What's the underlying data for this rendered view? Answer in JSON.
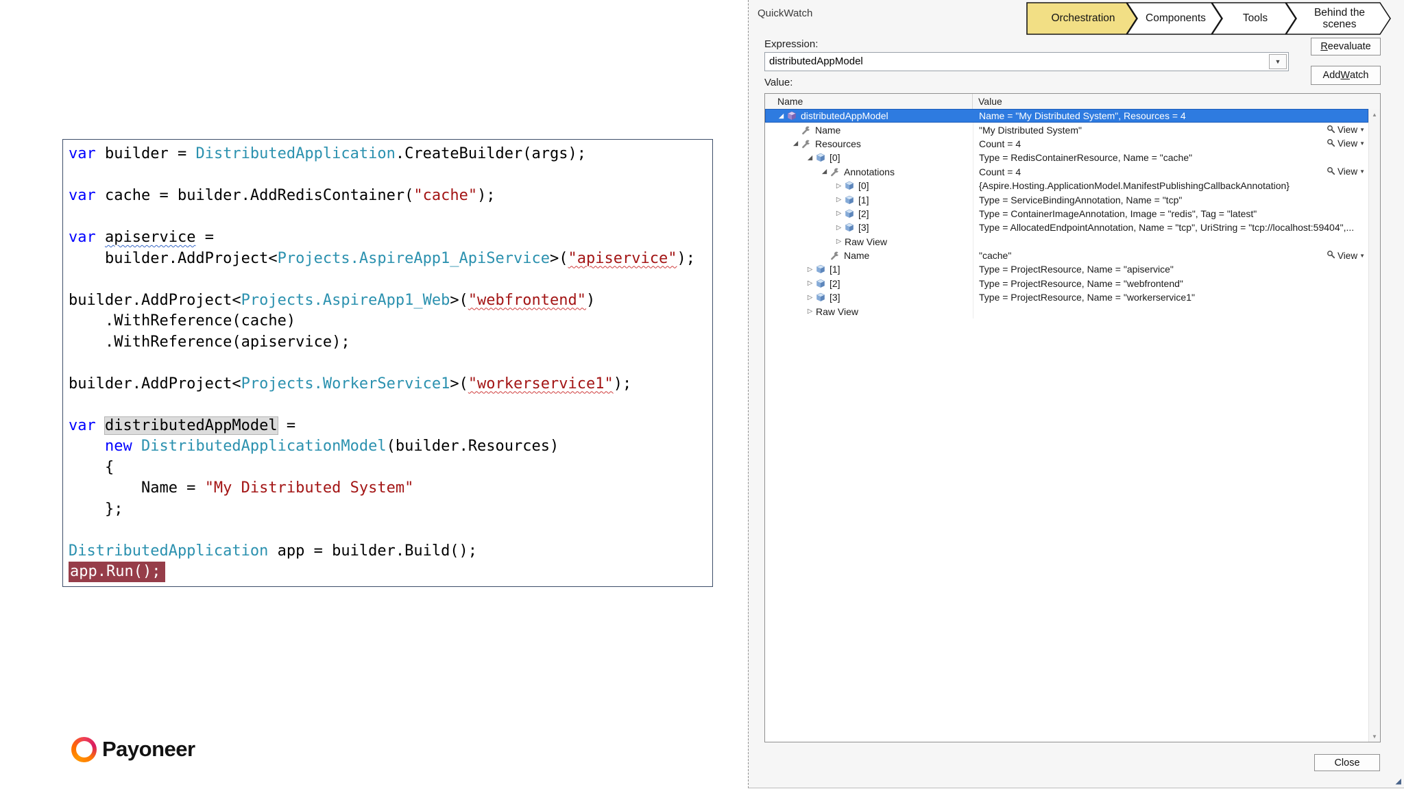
{
  "colors": {
    "selection": "#2e7be0",
    "tab_active": "#f2df85",
    "breakpoint_bg": "#963d49",
    "keyword": "#0000ff",
    "type": "#2b91af",
    "string": "#a31515",
    "symbol_highlight_bg": "#dcdcdc"
  },
  "icons": {
    "up": "▲",
    "down": "▼",
    "combo_arrow": "▼",
    "expanded": "◢",
    "collapsed": "▷",
    "view_arrow": "▼",
    "grip": "◢"
  },
  "slide": {
    "logo": {
      "brand": "Payoneer"
    },
    "code": {
      "lines": [
        [
          {
            "t": "var",
            "c": "kw"
          },
          {
            "t": " builder = ",
            "c": "pl"
          },
          {
            "t": "DistributedApplication",
            "c": "ty"
          },
          {
            "t": ".CreateBuilder(args);",
            "c": "pl"
          }
        ],
        [],
        [
          {
            "t": "var",
            "c": "kw"
          },
          {
            "t": " cache = builder.AddRedisContainer(",
            "c": "pl"
          },
          {
            "t": "\"cache\"",
            "c": "str"
          },
          {
            "t": ");",
            "c": "pl"
          }
        ],
        [],
        [
          {
            "t": "var",
            "c": "kw"
          },
          {
            "t": " ",
            "c": "pl"
          },
          {
            "t": "apiservice",
            "c": "idsq"
          },
          {
            "t": " =",
            "c": "pl"
          }
        ],
        [
          {
            "t": "    builder.AddProject<",
            "c": "pl"
          },
          {
            "t": "Projects.AspireApp1_ApiService",
            "c": "ty"
          },
          {
            "t": ">(",
            "c": "pl"
          },
          {
            "t": "\"apiservice\"",
            "c": "strsq"
          },
          {
            "t": ");",
            "c": "pl"
          }
        ],
        [],
        [
          {
            "t": "builder.AddProject<",
            "c": "pl"
          },
          {
            "t": "Projects.AspireApp1_Web",
            "c": "ty"
          },
          {
            "t": ">(",
            "c": "pl"
          },
          {
            "t": "\"webfrontend\"",
            "c": "strsq"
          },
          {
            "t": ")",
            "c": "pl"
          }
        ],
        [
          {
            "t": "    .WithReference(cache)",
            "c": "pl"
          }
        ],
        [
          {
            "t": "    .WithReference(apiservice);",
            "c": "pl"
          }
        ],
        [],
        [
          {
            "t": "builder.AddProject<",
            "c": "pl"
          },
          {
            "t": "Projects.WorkerService1",
            "c": "ty"
          },
          {
            "t": ">(",
            "c": "pl"
          },
          {
            "t": "\"workerservice1\"",
            "c": "strsq"
          },
          {
            "t": ");",
            "c": "pl"
          }
        ],
        [],
        [
          {
            "t": "var",
            "c": "kw"
          },
          {
            "t": " ",
            "c": "pl"
          },
          {
            "t": "distributedAppModel",
            "c": "hl"
          },
          {
            "t": " =",
            "c": "pl"
          }
        ],
        [
          {
            "t": "    ",
            "c": "pl"
          },
          {
            "t": "new",
            "c": "kw"
          },
          {
            "t": " ",
            "c": "pl"
          },
          {
            "t": "DistributedApplicationModel",
            "c": "ty"
          },
          {
            "t": "(builder.Resources)",
            "c": "pl"
          }
        ],
        [
          {
            "t": "    {",
            "c": "pl"
          }
        ],
        [
          {
            "t": "        Name = ",
            "c": "pl"
          },
          {
            "t": "\"My Distributed System\"",
            "c": "str"
          }
        ],
        [
          {
            "t": "    };",
            "c": "pl"
          }
        ],
        [],
        [
          {
            "t": "DistributedApplication",
            "c": "ty"
          },
          {
            "t": " app = builder.Build();",
            "c": "pl"
          }
        ],
        [
          {
            "t": "app.Run();",
            "c": "brk"
          }
        ]
      ]
    }
  },
  "dialog": {
    "title": "QuickWatch",
    "tabs": [
      {
        "label": "Orchestration",
        "fill": "#f2df85"
      },
      {
        "label": "Components",
        "fill": "#ffffff"
      },
      {
        "label": "Tools",
        "fill": "#ffffff"
      },
      {
        "label": "Behind the scenes",
        "fill": "#ffffff"
      }
    ],
    "expression_label": "Expression:",
    "expression_value": "distributedAppModel",
    "value_label": "Value:",
    "buttons": {
      "reevaluate": {
        "pre": "",
        "key": "R",
        "rest": "eevaluate"
      },
      "add_watch": {
        "pre": "Add ",
        "key": "W",
        "rest": "atch"
      },
      "close": {
        "label": "Close"
      }
    },
    "grid": {
      "columns": [
        "Name",
        "Value"
      ],
      "view_label": "View",
      "rows": [
        {
          "level": 0,
          "exp": "open",
          "icon": "cube-purple",
          "name": "distributedAppModel",
          "value": "Name = \"My Distributed System\", Resources = 4",
          "selected": true
        },
        {
          "level": 1,
          "exp": "",
          "icon": "wrench",
          "name": "Name",
          "value": "\"My Distributed System\"",
          "view": true
        },
        {
          "level": 1,
          "exp": "open",
          "icon": "wrench",
          "name": "Resources",
          "value": "Count = 4",
          "view": true
        },
        {
          "level": 2,
          "exp": "open",
          "icon": "cube",
          "name": "[0]",
          "value": "Type = RedisContainerResource, Name = \"cache\""
        },
        {
          "level": 3,
          "exp": "open",
          "icon": "wrench",
          "name": "Annotations",
          "value": "Count = 4",
          "view": true
        },
        {
          "level": 4,
          "exp": "closed",
          "icon": "cube",
          "name": "[0]",
          "value": "{Aspire.Hosting.ApplicationModel.ManifestPublishingCallbackAnnotation}"
        },
        {
          "level": 4,
          "exp": "closed",
          "icon": "cube",
          "name": "[1]",
          "value": "Type = ServiceBindingAnnotation, Name = \"tcp\""
        },
        {
          "level": 4,
          "exp": "closed",
          "icon": "cube",
          "name": "[2]",
          "value": "Type = ContainerImageAnnotation, Image = \"redis\", Tag = \"latest\""
        },
        {
          "level": 4,
          "exp": "closed",
          "icon": "cube",
          "name": "[3]",
          "value": "Type = AllocatedEndpointAnnotation, Name = \"tcp\", UriString = \"tcp://localhost:59404\",..."
        },
        {
          "level": 4,
          "exp": "closed",
          "icon": "",
          "name": "Raw View",
          "value": ""
        },
        {
          "level": 3,
          "exp": "",
          "icon": "wrench",
          "name": "Name",
          "value": "\"cache\"",
          "view": true
        },
        {
          "level": 2,
          "exp": "closed",
          "icon": "cube",
          "name": "[1]",
          "value": "Type = ProjectResource, Name = \"apiservice\""
        },
        {
          "level": 2,
          "exp": "closed",
          "icon": "cube",
          "name": "[2]",
          "value": "Type = ProjectResource, Name = \"webfrontend\""
        },
        {
          "level": 2,
          "exp": "closed",
          "icon": "cube",
          "name": "[3]",
          "value": "Type = ProjectResource, Name = \"workerservice1\""
        },
        {
          "level": 2,
          "exp": "closed",
          "icon": "",
          "name": "Raw View",
          "value": ""
        }
      ]
    }
  }
}
